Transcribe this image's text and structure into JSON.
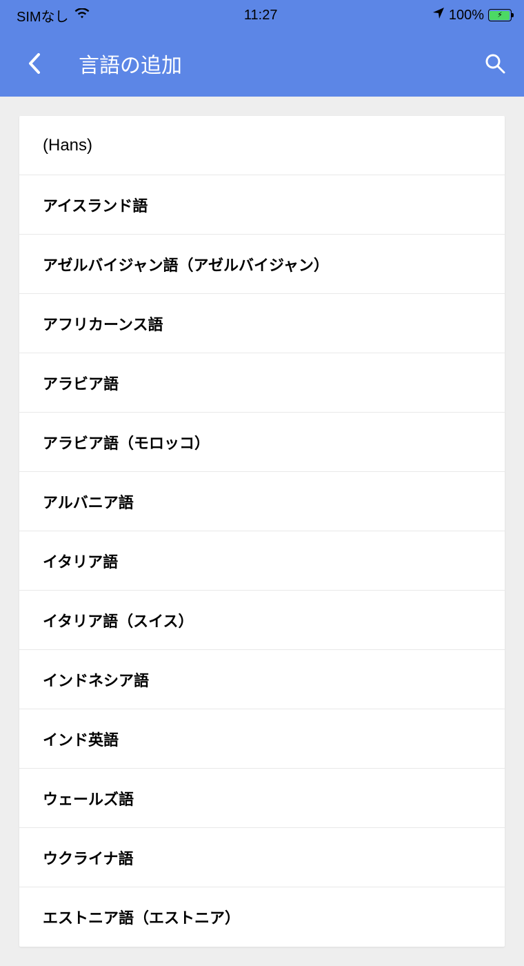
{
  "statusBar": {
    "carrier": "SIMなし",
    "time": "11:27",
    "battery": "100%"
  },
  "header": {
    "title": "言語の追加"
  },
  "languages": [
    " (Hans)",
    "アイスランド語",
    "アゼルバイジャン語（アゼルバイジャン）",
    "アフリカーンス語",
    "アラビア語",
    "アラビア語（モロッコ）",
    "アルバニア語",
    "イタリア語",
    "イタリア語（スイス）",
    "インドネシア語",
    "インド英語",
    "ウェールズ語",
    "ウクライナ語",
    "エストニア語（エストニア）"
  ]
}
